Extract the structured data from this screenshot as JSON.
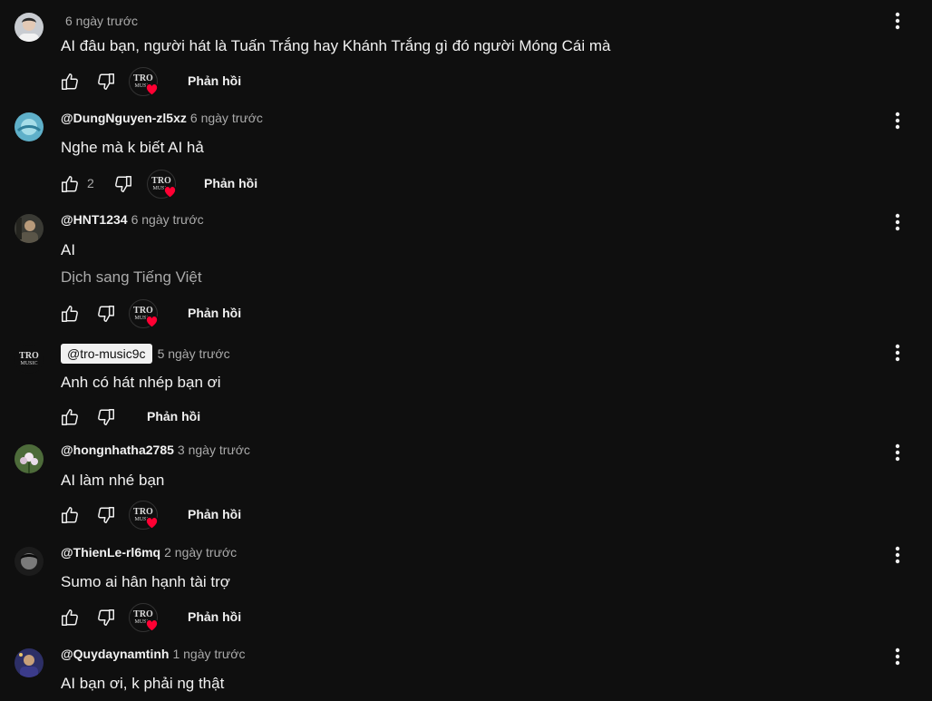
{
  "reply_label": "Phản hồi",
  "comments": [
    {
      "author": "",
      "time": "6 ngày trước",
      "text": "AI đâu bạn, người hát là Tuấn Trắng hay Khánh Trắng gì đó người Móng Cái mà",
      "likes": ""
    },
    {
      "author": "@DungNguyen-zl5xz",
      "time": "6 ngày trước",
      "text": "Nghe mà k biết AI hả",
      "likes": "2"
    },
    {
      "author": "@HNT1234",
      "time": "6 ngày trước",
      "text": "AI",
      "translate": "Dịch sang Tiếng Việt",
      "likes": ""
    },
    {
      "author": "@tro-music9c",
      "time": "5 ngày trước",
      "text": "Anh có hát nhép bạn ơi",
      "likes": ""
    },
    {
      "author": "@hongnhatha2785",
      "time": "3 ngày trước",
      "text": "AI làm nhé bạn",
      "likes": ""
    },
    {
      "author": "@ThienLe-rl6mq",
      "time": "2 ngày trước",
      "text": "Sumo ai hân hạnh tài trợ",
      "likes": ""
    },
    {
      "author": "@Quydaynamtinh",
      "time": "1 ngày trước",
      "text": "AI bạn ơi, k phải ng thật",
      "likes": ""
    }
  ],
  "channel_badge": {
    "line1": "TRO",
    "line2": "MUSIC"
  },
  "colors": {
    "background": "#0f0f0f",
    "text": "#f1f1f1",
    "secondary": "#aaaaaa",
    "heart": "#ff0033"
  }
}
